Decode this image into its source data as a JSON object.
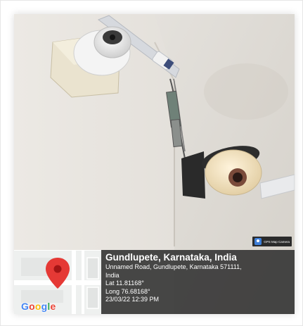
{
  "photo": {
    "subject_icons": [
      "dome-camera-icon",
      "dome-camera-icon"
    ]
  },
  "app_badge": {
    "label": "GPS Map Camera",
    "icon": "camera-icon"
  },
  "map": {
    "logo": [
      "G",
      "o",
      "o",
      "g",
      "l",
      "e"
    ],
    "pin_icon": "map-pin-icon",
    "colors": {
      "pin": "#e53935",
      "logo_blue": "#4285f4",
      "logo_red": "#ea4335",
      "logo_yellow": "#fbbc05",
      "logo_green": "#34a853"
    }
  },
  "location": {
    "title": "Gundlupete, Karnataka, India",
    "address_line_1": "Unnamed Road, Gundlupete, Karnataka 571111,",
    "address_line_2": "India",
    "latitude": "Lat 11.81168°",
    "longitude": "Long 76.68168°",
    "timestamp": "23/03/22 12:39 PM"
  }
}
